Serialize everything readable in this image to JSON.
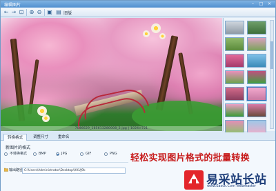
{
  "window": {
    "title": "编辑图片",
    "controls": [
      "–",
      "□",
      "×"
    ]
  },
  "toolbar": {
    "label": "旧版",
    "buttons": [
      {
        "name": "back-button",
        "glyph": "←"
      },
      {
        "name": "forward-button",
        "glyph": "→"
      },
      {
        "name": "fit-button",
        "glyph": "⊡"
      },
      {
        "name": "zoom-in-button",
        "glyph": "⊕"
      },
      {
        "name": "zoom-out-button",
        "glyph": "⊖"
      },
      {
        "name": "actual-size-button",
        "glyph": "▣"
      },
      {
        "name": "fullscreen-button",
        "glyph": "⤢"
      },
      {
        "name": "save-button",
        "glyph": "▤"
      }
    ]
  },
  "viewer": {
    "status": "7086629_185613280008_2.jpg  |  1024×721"
  },
  "thumbnails": {
    "count": 14,
    "selected_index": 9,
    "colors": [
      [
        "#cfd6de",
        "#8f9aa5"
      ],
      [
        "#6f9f6a",
        "#3e6e3a"
      ],
      [
        "#8fb86a",
        "#5a8a3a"
      ],
      [
        "#d9a0bd",
        "#7aa35a"
      ],
      [
        "#e46a9a",
        "#a43a6a"
      ],
      [
        "#7fc0e8",
        "#3a8ab8"
      ],
      [
        "#e98fbd",
        "#6aa34a"
      ],
      [
        "#c05080",
        "#40a040"
      ],
      [
        "#d46a8a",
        "#8a4060"
      ],
      [
        "#f2a9cd",
        "#c87aa4"
      ],
      [
        "#ec9fc6",
        "#3c9b34"
      ],
      [
        "#d87aa8",
        "#6a4a3a"
      ],
      [
        "#e48fb8",
        "#8fc070"
      ],
      [
        "#a0c8e8",
        "#e8b0cc"
      ]
    ]
  },
  "tabs": [
    {
      "label": "转换格式",
      "active": true
    },
    {
      "label": "调整尺寸",
      "active": false
    },
    {
      "label": "重命名",
      "active": false
    }
  ],
  "format_panel": {
    "title": "新图片的格式",
    "options": [
      {
        "label": "不转换格式",
        "selected": false
      },
      {
        "label": "BMP",
        "selected": false
      },
      {
        "label": "JPG",
        "selected": true
      },
      {
        "label": "GIF",
        "selected": false
      },
      {
        "label": "PNG",
        "selected": false
      }
    ]
  },
  "output": {
    "label": "输出路径",
    "path": "C:\\Users\\Administrator\\Desktop\\XKUJ9k"
  },
  "caption": "轻松实现图片格式的批量转换",
  "logo": {
    "name": "易采站长站",
    "url": "www.Easck.Com  Webmaster"
  }
}
